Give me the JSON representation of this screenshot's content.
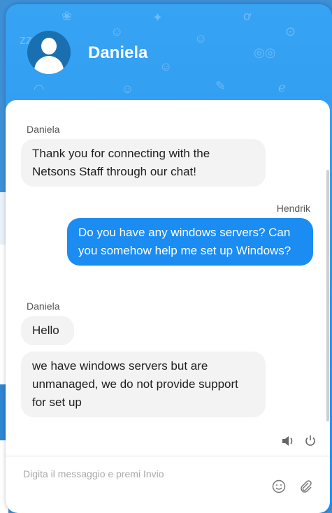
{
  "header": {
    "agent_name": "Daniela"
  },
  "messages": [
    {
      "sender": "Daniela",
      "direction": "in",
      "texts": [
        "Thank you for connecting with the Netsons Staff through our chat!"
      ]
    },
    {
      "sender": "Hendrik",
      "direction": "out",
      "texts": [
        "Do you have any windows servers? Can you somehow help me set up Windows?"
      ]
    },
    {
      "sender": "Daniela",
      "direction": "in",
      "texts": [
        "Hello",
        "we have windows servers but are unmanaged, we do not provide support for set up"
      ]
    }
  ],
  "controls": {
    "sound_icon": "speaker-icon",
    "power_icon": "power-icon"
  },
  "composer": {
    "placeholder": "Digita il messaggio e premi Invio",
    "value": ""
  },
  "tools": {
    "emoji_icon": "emoji-icon",
    "attach_icon": "paperclip-icon"
  },
  "colors": {
    "header": "#1e8ff0",
    "outgoing_bubble": "#1b8cf2",
    "incoming_bubble": "#f3f3f3"
  }
}
